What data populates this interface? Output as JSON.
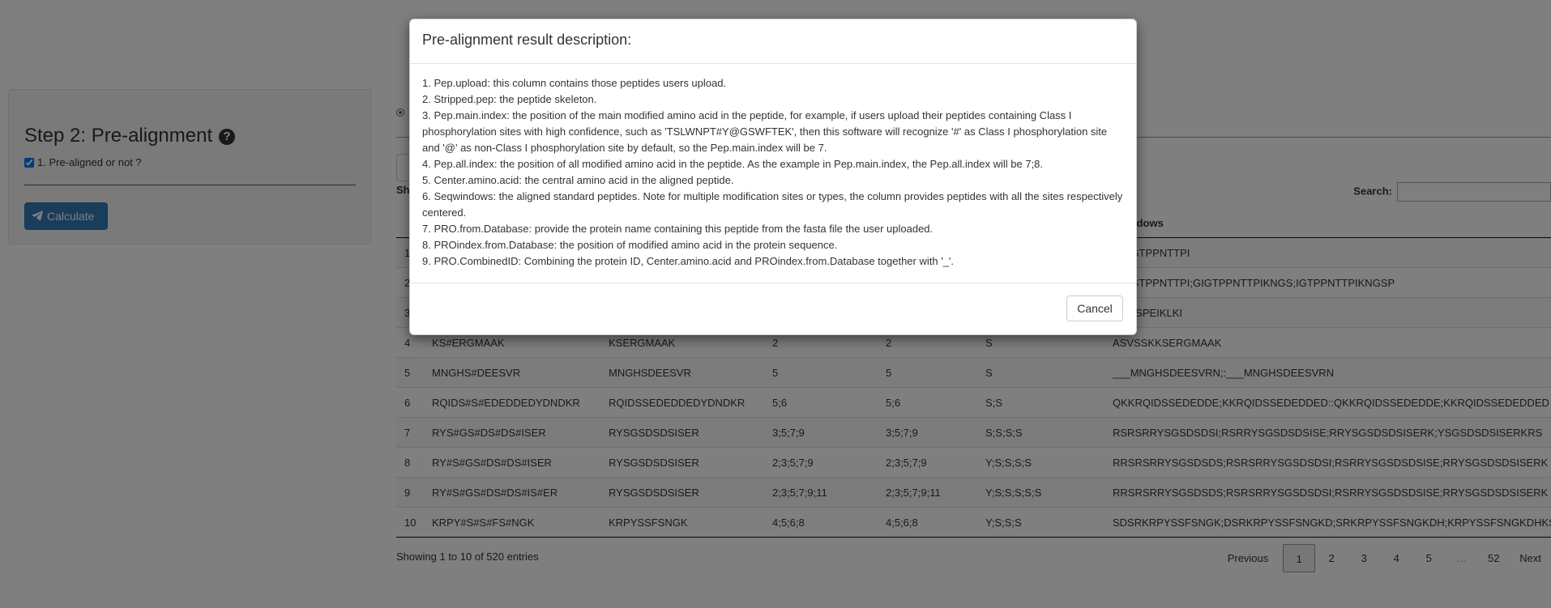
{
  "sidebar": {
    "title": "Step 2: Pre-alignment",
    "help_icon": "question-circle-icon",
    "checkbox_label": "1. Pre-aligned or not ?",
    "checkbox_checked": true,
    "calculate_label": "Calculate",
    "calculate_icon": "paper-plane-icon"
  },
  "main": {
    "show_label": "Sh",
    "search_label": "Search:",
    "search_value": "",
    "columns": [
      "",
      "",
      "",
      "",
      "",
      "",
      "qwindows"
    ],
    "rows": [
      [
        "1",
        "",
        "",
        "",
        "",
        "",
        "KGIGTPPNTTPI"
      ],
      [
        "2",
        "",
        "",
        "",
        "",
        "",
        "KGIGTPPNTTPI;GIGTPPNTTPIKNGS;IGTPPNTTPIKNGSP"
      ],
      [
        "3",
        "",
        "",
        "",
        "",
        "",
        "KNGSPEIKLKI"
      ],
      [
        "4",
        "KS#ERGMAAK",
        "KSERGMAAK",
        "2",
        "2",
        "S",
        "ASVSSKKSERGMAAK"
      ],
      [
        "5",
        "MNGHS#DEESVR",
        "MNGHSDEESVR",
        "5",
        "5",
        "S",
        "___MNGHSDEESVRN;:___MNGHSDEESVRN"
      ],
      [
        "6",
        "RQIDS#S#EDEDDEDYDNDKR",
        "RQIDSSEDEDDEDYDNDKR",
        "5;6",
        "5;6",
        "S;S",
        "QKKRQIDSSEDEDDE;KKRQIDSSEDEDDED::QKKRQIDSSEDEDDE;KKRQIDSSEDEDDED"
      ],
      [
        "7",
        "RYS#GS#DS#DS#ISER",
        "RYSGSDSDSISER",
        "3;5;7;9",
        "3;5;7;9",
        "S;S;S;S",
        "RSRSRRYSGSDSDSI;RSRRYSGSDSDSISE;RRYSGSDSDSISERK;YSGSDSDSISERKRS"
      ],
      [
        "8",
        "RY#S#GS#DS#DS#ISER",
        "RYSGSDSDSISER",
        "2;3;5;7;9",
        "2;3;5;7;9",
        "Y;S;S;S;S",
        "RRSRSRRYSGSDSDS;RSRSRRYSGSDSDSI;RSRRYSGSDSDSISE;RRYSGSDSDSISERK"
      ],
      [
        "9",
        "RY#S#GS#DS#DS#IS#ER",
        "RYSGSDSDSISER",
        "2;3;5;7;9;11",
        "2;3;5;7;9;11",
        "Y;S;S;S;S;S",
        "RRSRSRRYSGSDSDS;RSRSRRYSGSDSDSI;RSRRYSGSDSDSISE;RRYSGSDSDSISERK"
      ],
      [
        "10",
        "KRPY#S#S#FS#NGK",
        "KRPYSSFSNGK",
        "4;5;6;8",
        "4;5;6;8",
        "Y;S;S;S",
        "SDSRKRPYSSFSNGK;DSRKRPYSSFSNGKD;SRKRPYSSFSNGKDH;KRPYSSFSNGKDHKS"
      ]
    ],
    "info": "Showing 1 to 10 of 520 entries",
    "pagination": {
      "previous": "Previous",
      "pages": [
        "1",
        "2",
        "3",
        "4",
        "5",
        "…",
        "52"
      ],
      "next": "Next"
    }
  },
  "modal": {
    "title": "Pre-alignment result description:",
    "lines": [
      "1. Pep.upload: this column contains those peptides users upload.",
      "2. Stripped.pep: the peptide skeleton.",
      "3. Pep.main.index: the position of the main modified amino acid in the peptide, for example, if users upload their peptides containing Class I phosphorylation sites with high confidence, such as 'TSLWNPT#Y@GSWFTEK', then this software will recognize '#' as Class I phosphorylation site and '@' as non-Class I phosphorylation site by default, so the Pep.main.index will be 7.",
      "4. Pep.all.index: the position of all modified amino acid in the peptide. As the example in Pep.main.index, the Pep.all.index will be 7;8.",
      "5. Center.amino.acid: the central amino acid in the aligned peptide.",
      "6. Seqwindows: the aligned standard peptides. Note for multiple modification sites or types, the column provides peptides with all the sites respectively centered.",
      "7. PRO.from.Database: provide the protein name containing this peptide from the fasta file the user uploaded.",
      "8. PROindex.from.Database: the position of modified amino acid in the protein sequence.",
      "9. PRO.CombinedID: Combining the protein ID, Center.amino.acid and PROindex.from.Database together with '_'."
    ],
    "cancel_label": "Cancel"
  }
}
